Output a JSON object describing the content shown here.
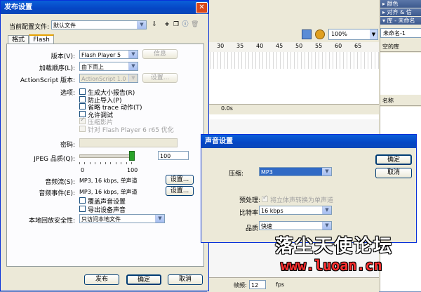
{
  "background": {
    "zoom_value": "100%",
    "ruler_numbers": [
      "30",
      "35",
      "40",
      "45",
      "50",
      "55",
      "60",
      "65"
    ],
    "status_time": "0.0s",
    "fps_value": "12",
    "fps_label": "fps",
    "frame_rate_label": "帧频:",
    "right_panel": {
      "color_header": "▸ 颜色",
      "align_header": "▸ 对齐 & 信",
      "library_header": "▾ 库 - 未命名",
      "library_select": "未命名-1",
      "empty_library": "空的库",
      "name_col": "名称"
    }
  },
  "publish_dialog": {
    "title": "发布设置",
    "profile_label": "当前配置文件:",
    "profile_value": "默认文件",
    "tabs": [
      "格式",
      "Flash"
    ],
    "version_label": "版本(V):",
    "version_value": "Flash Player 5",
    "info_button": "信息",
    "load_order_label": "加载顺序(L):",
    "load_order_value": "由下而上",
    "as_version_label": "ActionScript 版本:",
    "as_version_value": "ActionScript 1.0",
    "as_settings_button": "设置...",
    "options_label": "选项:",
    "options": [
      {
        "label": "生成大小报告(R)",
        "checked": false,
        "disabled": false
      },
      {
        "label": "防止导入(P)",
        "checked": false,
        "disabled": false
      },
      {
        "label": "省略 trace 动作(T)",
        "checked": false,
        "disabled": false
      },
      {
        "label": "允许调试",
        "checked": false,
        "disabled": false
      },
      {
        "label": "压缩影片",
        "checked": true,
        "disabled": true
      },
      {
        "label": "针对 Flash Player 6 r65 优化",
        "checked": false,
        "disabled": true
      }
    ],
    "password_label": "密码:",
    "jpeg_label": "JPEG 品质(Q):",
    "jpeg_value": "100",
    "jpeg_value_number": 100,
    "slider_min": "0",
    "slider_max": "100",
    "audio_stream_label": "音频流(S):",
    "audio_stream_value": "MP3, 16 kbps, 单声道",
    "audio_stream_button": "设置...",
    "audio_event_label": "音频事件(E):",
    "audio_event_value": "MP3, 16 kbps, 单声道",
    "audio_event_button": "设置...",
    "override_sound": "覆盖声音设置",
    "export_device_sound": "导出设备声音",
    "local_security_label": "本地回放安全性:",
    "local_security_value": "只访问本地文件",
    "publish_button": "发布",
    "ok_button": "确定",
    "cancel_button": "取消"
  },
  "sound_dialog": {
    "title": "声音设置",
    "compression_label": "压缩:",
    "compression_value": "MP3",
    "preprocess_label": "预处理:",
    "preprocess_checkbox": "将立体声转换为单声道",
    "bitrate_label": "比特率:",
    "bitrate_value": "16 kbps",
    "quality_label": "品质:",
    "quality_value": "快速",
    "ok_button": "确定",
    "cancel_button": "取消"
  },
  "watermark": {
    "text": "落尘天使论坛",
    "url": "www.luoan.cn"
  }
}
